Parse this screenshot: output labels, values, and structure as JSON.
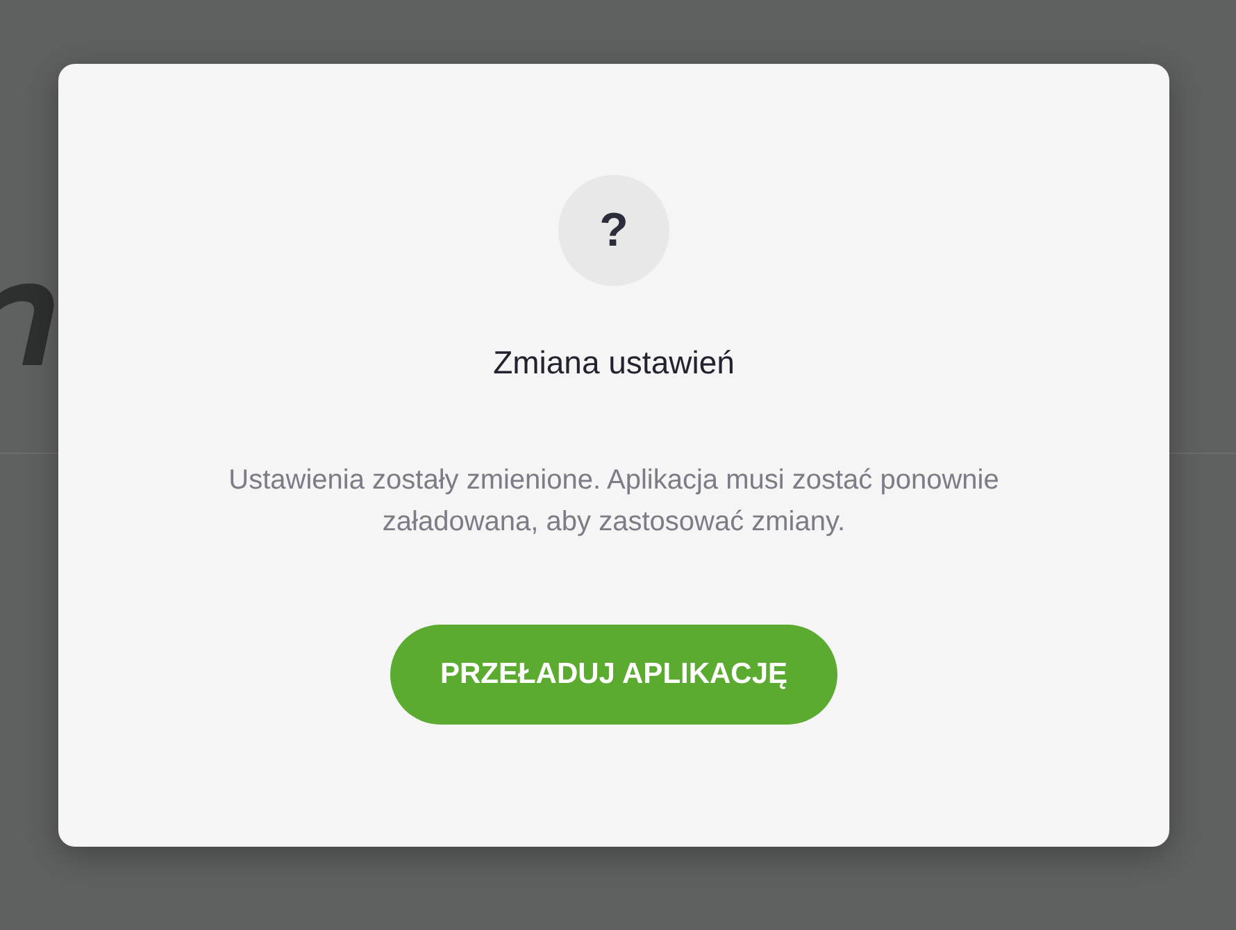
{
  "dialog": {
    "icon": "?",
    "title": "Zmiana ustawień",
    "message": "Ustawienia zostały zmienione. Aplikacja musi zostać ponownie załadowana, aby zastosować zmiany.",
    "button": "PRZEŁADUJ APLIKACJĘ"
  }
}
